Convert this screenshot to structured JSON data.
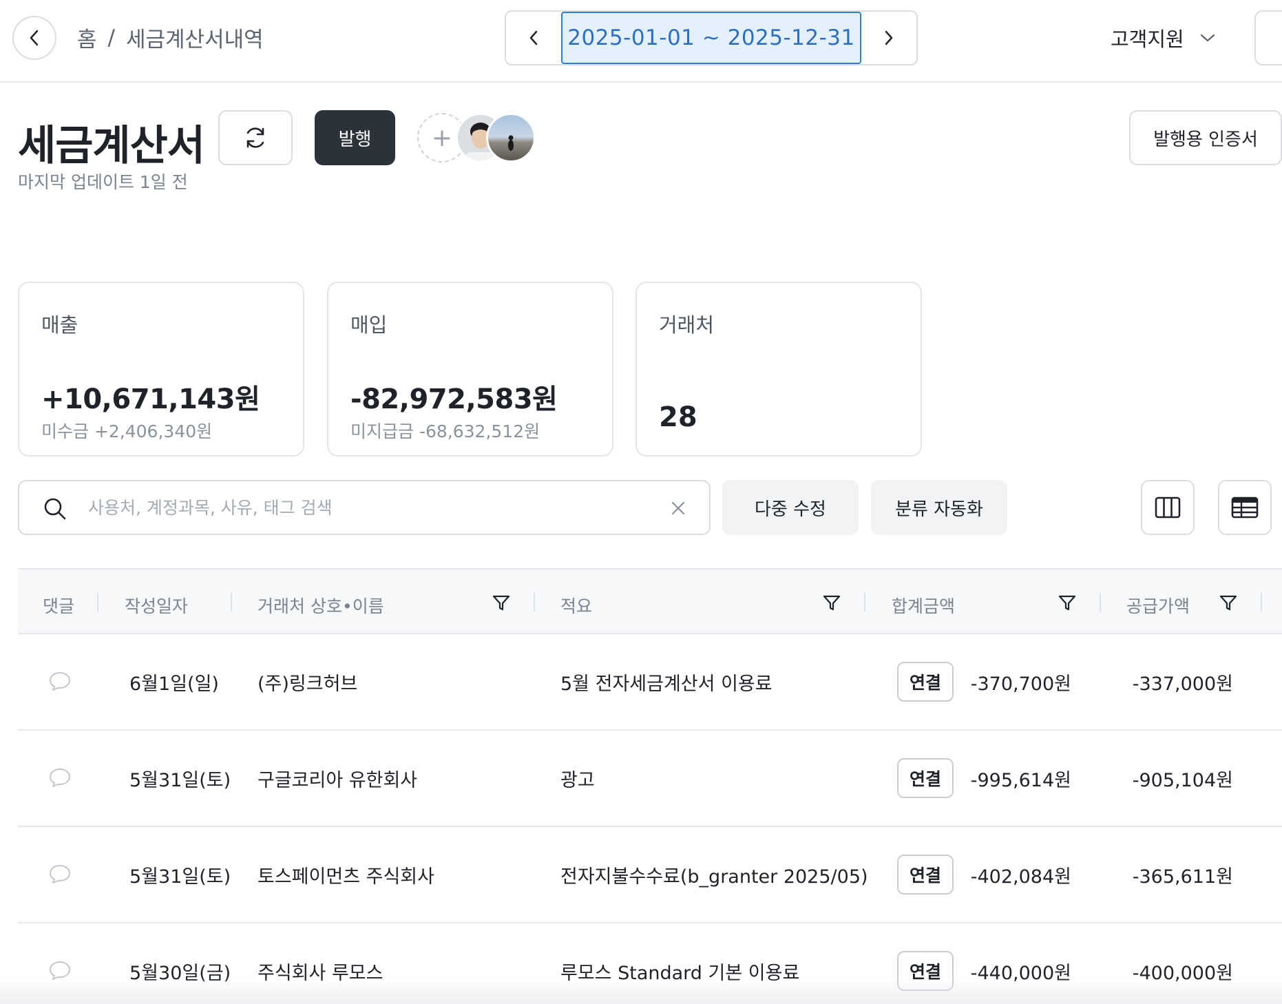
{
  "topbar": {
    "breadcrumb_home": "홈",
    "breadcrumb_sep": "/",
    "breadcrumb_current": "세금계산서내역",
    "date_range": "2025-01-01 ~ 2025-12-31",
    "support_label": "고객지원"
  },
  "header": {
    "title": "세금계산서",
    "last_update": "마지막 업데이트 1일 전",
    "issue_label": "발행",
    "add_member_symbol": "+",
    "cert_label": "발행용 인증서"
  },
  "cards": {
    "sales": {
      "label": "매출",
      "value": "+10,671,143원",
      "sub": "미수금 +2,406,340원"
    },
    "purchase": {
      "label": "매입",
      "value": "-82,972,583원",
      "sub": "미지급금 -68,632,512원"
    },
    "partners": {
      "label": "거래처",
      "value": "28"
    }
  },
  "toolbar": {
    "search_placeholder": "사용처, 계정과목, 사유, 태그 검색",
    "multi_edit_label": "다중 수정",
    "auto_class_label": "분류 자동화"
  },
  "table": {
    "headers": {
      "comment": "댓글",
      "date": "작성일자",
      "partner": "거래처 상호•이름",
      "summary": "적요",
      "total": "합계금액",
      "supply": "공급가액"
    },
    "rows": [
      {
        "date": "6월1일(일)",
        "partner": "(주)링크허브",
        "summary": "5월 전자세금계산서 이용료",
        "badge": "연결",
        "total": "-370,700원",
        "supply": "-337,000원"
      },
      {
        "date": "5월31일(토)",
        "partner": "구글코리아 유한회사",
        "summary": "광고",
        "badge": "연결",
        "total": "-995,614원",
        "supply": "-905,104원"
      },
      {
        "date": "5월31일(토)",
        "partner": "토스페이먼츠 주식회사",
        "summary": "전자지불수수료(b_granter 2025/05)",
        "badge": "연결",
        "total": "-402,084원",
        "supply": "-365,611원"
      },
      {
        "date": "5월30일(금)",
        "partner": "주식회사 루모스",
        "summary": "루모스 Standard 기본 이용료",
        "badge": "연결",
        "total": "-440,000원",
        "supply": "-400,000원"
      }
    ]
  },
  "colors": {
    "primary_dark": "#2c3239",
    "date_range_bg": "#e4f1fd",
    "date_range_border": "#2f7fd8",
    "date_range_text": "#2c6fc2",
    "muted_text": "#7a8390"
  },
  "icons": [
    "back-icon",
    "chevron-left-icon",
    "chevron-right-icon",
    "chevron-down-icon",
    "refresh-icon",
    "search-icon",
    "close-icon",
    "columns-icon",
    "table-view-icon",
    "filter-icon",
    "comment-icon"
  ]
}
